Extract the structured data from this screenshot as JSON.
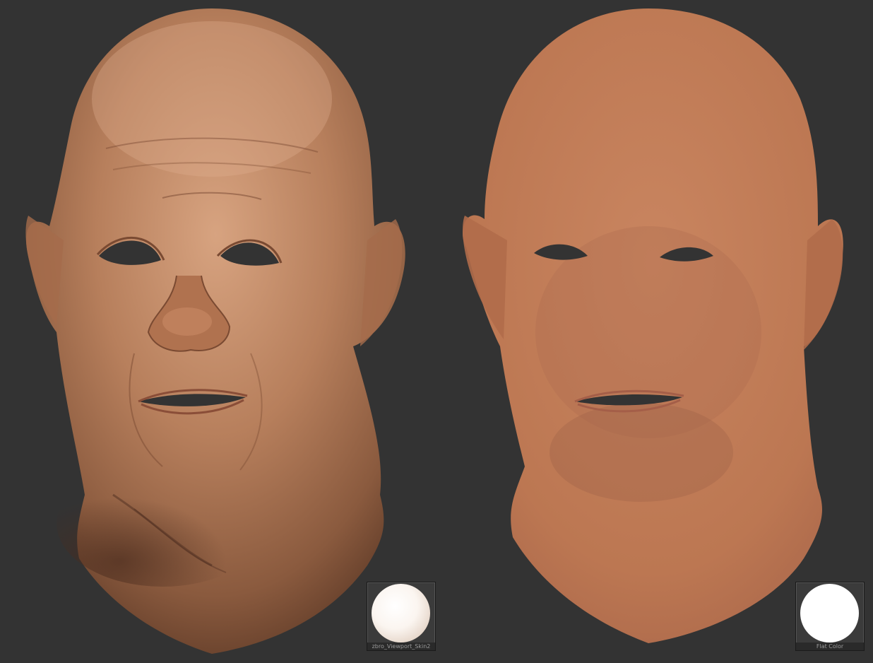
{
  "viewport": {
    "background": "#333333"
  },
  "left_render": {
    "material_name": "zbro_Viewport_Skin2",
    "skin_color": "#b98060"
  },
  "right_render": {
    "material_name": "Flat Color",
    "skin_color": "#c07a55"
  }
}
